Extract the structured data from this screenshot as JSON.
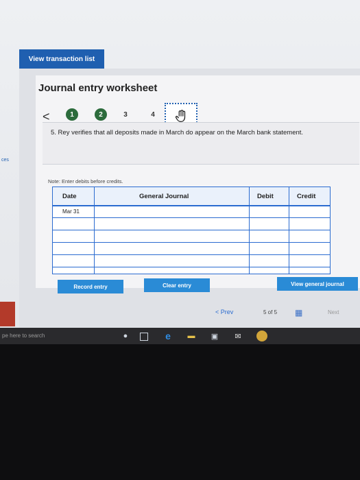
{
  "header": {
    "view_transaction_list": "View transaction list"
  },
  "worksheet": {
    "title": "Journal entry worksheet",
    "prev_symbol": "<",
    "steps": [
      "1",
      "2",
      "3",
      "4"
    ],
    "description": "5. Rey verifies that all deposits made in March do appear on the March bank statement.",
    "note": "Note: Enter debits before credits."
  },
  "sidebar": {
    "fragment": "ces"
  },
  "journal": {
    "columns": {
      "date": "Date",
      "general_journal": "General Journal",
      "debit": "Debit",
      "credit": "Credit"
    },
    "rows": [
      {
        "date": "Mar 31"
      },
      {
        "date": ""
      },
      {
        "date": ""
      },
      {
        "date": ""
      },
      {
        "date": ""
      },
      {
        "date": ""
      }
    ]
  },
  "actions": {
    "record_entry": "Record entry",
    "clear_entry": "Clear entry",
    "view_general_journal": "View general journal"
  },
  "pagination": {
    "prev": "< Prev",
    "position": "5 of 5",
    "next": "Next"
  },
  "taskbar": {
    "search_placeholder": "pe here to search"
  },
  "colors": {
    "brand_blue": "#1f5fb0",
    "step_green": "#2c6b3c",
    "button_blue": "#2a8bd6"
  }
}
